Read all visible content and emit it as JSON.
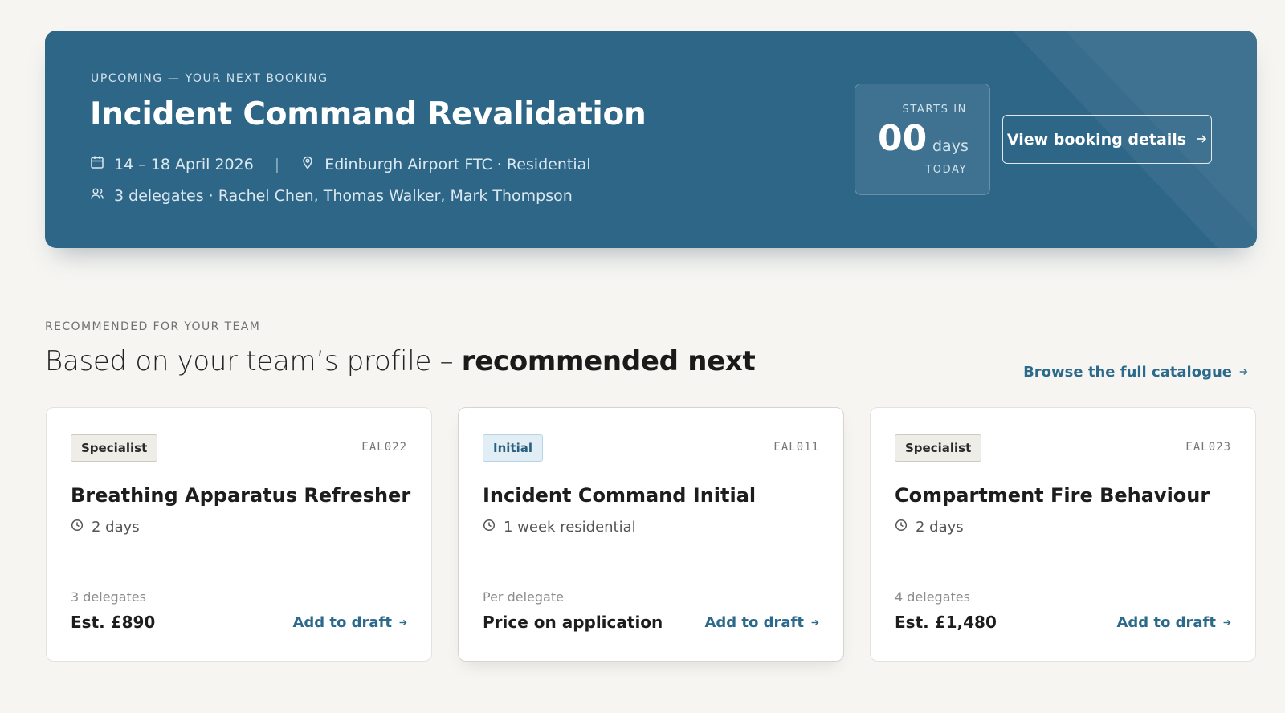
{
  "hero": {
    "eyebrow": "UPCOMING — YOUR NEXT BOOKING",
    "title": "Incident Command Revalidation",
    "dates": "14 – 18 April 2026",
    "divider": "|",
    "location": "Edinburgh Airport FTC · Residential",
    "delegates": "3 delegates · Rachel Chen, Thomas Walker, Mark Thompson",
    "countdown": {
      "label": "STARTS IN",
      "number": "00",
      "unit": "days",
      "sub": "TODAY"
    },
    "button_label": "View booking details",
    "colors": {
      "background": "#2e6687",
      "text": "#ffffff"
    }
  },
  "recommendations": {
    "eyebrow": "RECOMMENDED FOR YOUR TEAM",
    "title_plain": "Based on your team’s profile – ",
    "title_bold": "recommended next",
    "browse_label": "Browse the full catalogue",
    "cards": [
      {
        "badge": "Specialist",
        "code": "EAL022",
        "title": "Breathing Apparatus Refresher",
        "duration": "2 days",
        "meta": "3 delegates",
        "price": "Est. £890",
        "action": "Add to draft"
      },
      {
        "badge": "Initial",
        "code": "EAL011",
        "title": "Incident Command Initial",
        "duration": "1 week residential",
        "meta": "Per delegate",
        "price": "Price on application",
        "action": "Add to draft"
      },
      {
        "badge": "Specialist",
        "code": "EAL023",
        "title": "Compartment Fire Behaviour",
        "duration": "2 days",
        "meta": "4 delegates",
        "price": "Est. £1,480",
        "action": "Add to draft"
      }
    ],
    "colors": {
      "link": "#2c6a8c"
    }
  }
}
